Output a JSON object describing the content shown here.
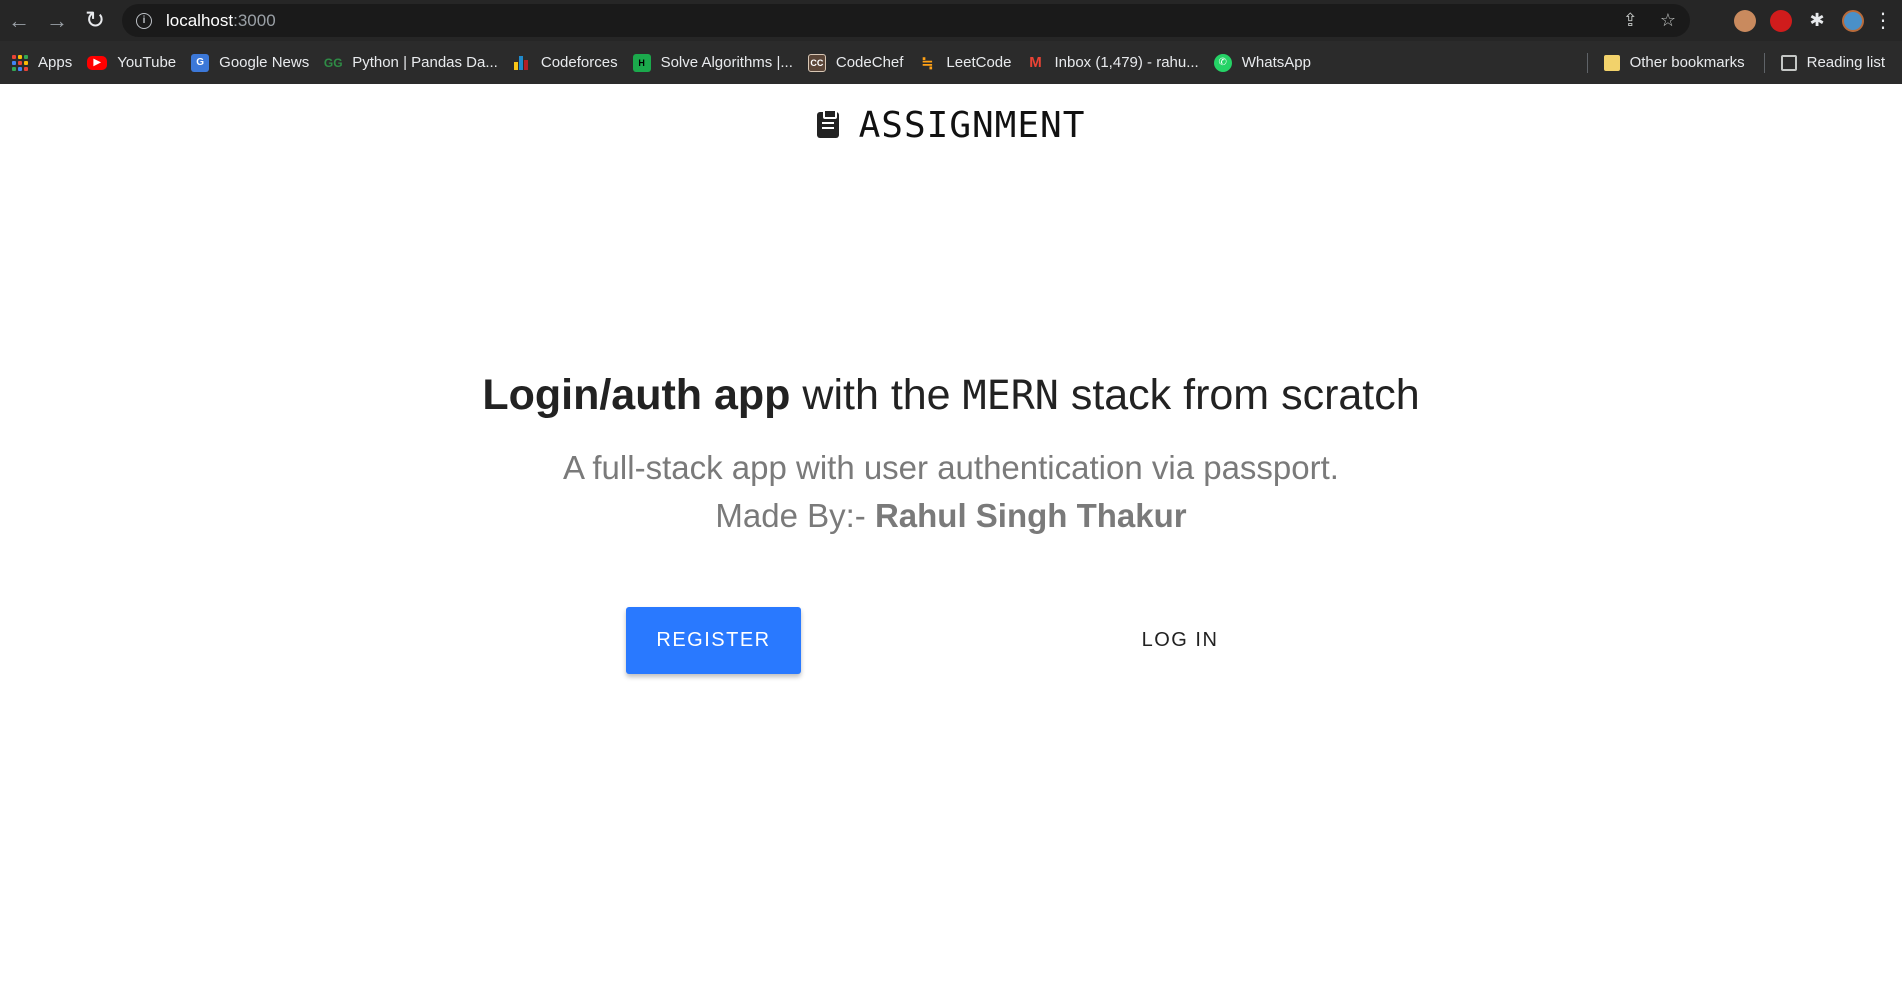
{
  "browser": {
    "url_host": "localhost",
    "url_port": ":3000",
    "bookmarks": [
      {
        "label": "Apps",
        "icon": "apps-grid-icon"
      },
      {
        "label": "YouTube",
        "icon": "youtube-icon"
      },
      {
        "label": "Google News",
        "icon": "google-news-icon"
      },
      {
        "label": "Python | Pandas Da...",
        "icon": "geeksforgeeks-icon"
      },
      {
        "label": "Codeforces",
        "icon": "codeforces-icon"
      },
      {
        "label": "Solve Algorithms |...",
        "icon": "hackerrank-icon"
      },
      {
        "label": "CodeChef",
        "icon": "codechef-icon"
      },
      {
        "label": "LeetCode",
        "icon": "leetcode-icon"
      },
      {
        "label": "Inbox (1,479) - rahu...",
        "icon": "gmail-icon"
      },
      {
        "label": "WhatsApp",
        "icon": "whatsapp-icon"
      }
    ],
    "other_bookmarks": "Other bookmarks",
    "reading_list": "Reading list",
    "icon_glyphs": {
      "back": "←",
      "forward": "→",
      "reload": "↻",
      "info": "i",
      "share": "⇪",
      "star": "☆",
      "extensions": "✱",
      "menu": "⋮",
      "cc": "CC",
      "hr": "H",
      "gn": "G",
      "gfg": "GG",
      "lc": "≒",
      "gm": "M",
      "wa": "✆"
    }
  },
  "page": {
    "brand": "ASSIGNMENT",
    "headline_bold": "Login/auth app",
    "headline_mid": " with the ",
    "headline_mono": "MERN",
    "headline_end": " stack from scratch",
    "subline": "A full-stack app with user authentication via passport.",
    "made_by_prefix": "Made By:- ",
    "made_by_name": "Rahul Singh Thakur",
    "register_label": "REGISTER",
    "login_label": "LOG IN"
  },
  "colors": {
    "accent": "#2979ff",
    "toolbar": "#262626",
    "bookmarks_bar": "#2b2b2b"
  }
}
